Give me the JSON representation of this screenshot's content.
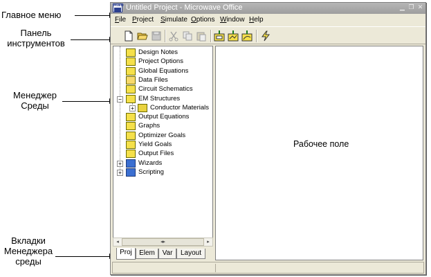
{
  "annotations": {
    "main_menu": "Главное меню",
    "toolbar_line1": "Панель",
    "toolbar_line2": "инструментов",
    "env_manager_line1": "Менеджер",
    "env_manager_line2": "Среды",
    "tabs_line1": "Вкладки",
    "tabs_line2": "Менеджера",
    "tabs_line3": "среды"
  },
  "window": {
    "title": "Untitled Project - Microwave Office",
    "app_icon_text": "MWO",
    "controls": [
      "minimize-icon",
      "restore-icon",
      "close-icon"
    ]
  },
  "menu": {
    "items": [
      "File",
      "Project",
      "Simulate",
      "Options",
      "Window",
      "Help"
    ]
  },
  "toolbar": {
    "icons": [
      "new-file-icon",
      "open-folder-icon",
      "save-icon",
      "cut-icon",
      "copy-icon",
      "paste-icon",
      "add-schematic-icon",
      "add-em-structure-icon",
      "add-graph-icon",
      "simulate-lightning-icon"
    ]
  },
  "tree": {
    "items": [
      {
        "label": "Design Notes",
        "icon": "design-notes-icon"
      },
      {
        "label": "Project Options",
        "icon": "project-options-icon"
      },
      {
        "label": "Global Equations",
        "icon": "global-equations-icon"
      },
      {
        "label": "Data Files",
        "icon": "data-files-folder-icon"
      },
      {
        "label": "Circuit Schematics",
        "icon": "circuit-schematics-icon"
      },
      {
        "label": "EM Structures",
        "icon": "em-structures-icon",
        "expander": "−"
      },
      {
        "label": "Conductor Materials",
        "icon": "conductor-materials-icon",
        "expander": "+"
      },
      {
        "label": "Output Equations",
        "icon": "output-equations-icon"
      },
      {
        "label": "Graphs",
        "icon": "graphs-icon"
      },
      {
        "label": "Optimizer Goals",
        "icon": "optimizer-goals-icon"
      },
      {
        "label": "Yield Goals",
        "icon": "yield-goals-icon"
      },
      {
        "label": "Output Files",
        "icon": "output-files-icon"
      },
      {
        "label": "Wizards",
        "icon": "wizards-icon",
        "expander": "+"
      },
      {
        "label": "Scripting",
        "icon": "scripting-icon",
        "expander": "+"
      }
    ]
  },
  "scrollbar": {
    "left_arrow": "◂",
    "thumb_grip": "◂▸",
    "right_arrow": "▸"
  },
  "tabs": [
    "Proj",
    "Elem",
    "Var",
    "Layout"
  ],
  "workspace": {
    "label": "Рабочее поле"
  },
  "colors": {
    "titlebar": "#a9a9a9",
    "window_bg": "#ece9d8",
    "tree_icon_fill": "#f5e04a"
  }
}
